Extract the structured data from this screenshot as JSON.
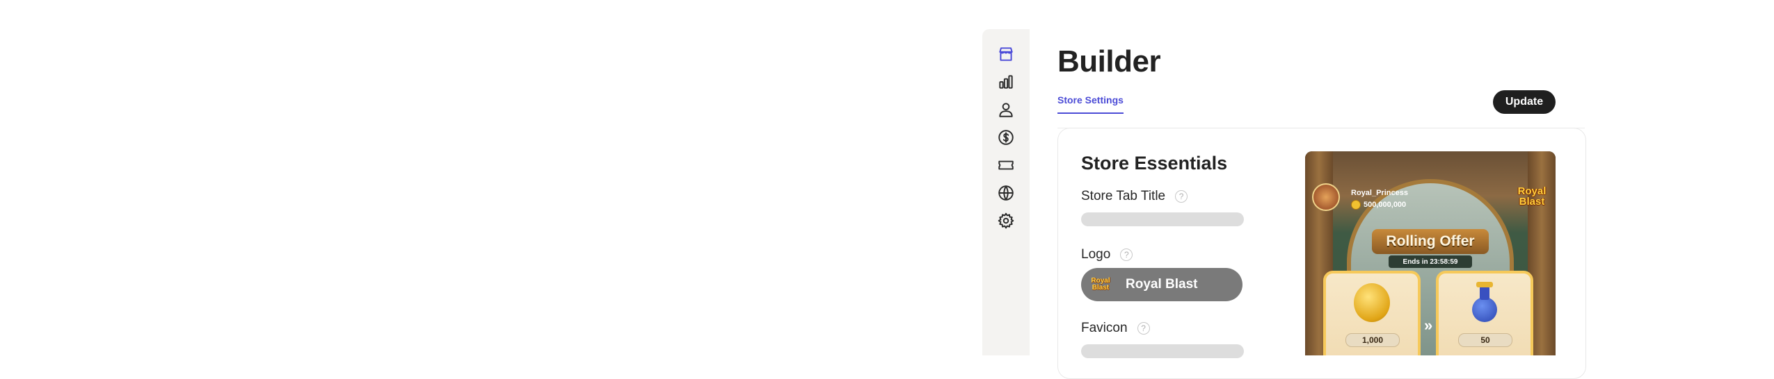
{
  "sidebar": {
    "items": [
      {
        "name": "store",
        "icon": "store-icon",
        "active": true
      },
      {
        "name": "analytics",
        "icon": "bar-chart-icon",
        "active": false
      },
      {
        "name": "users",
        "icon": "user-icon",
        "active": false
      },
      {
        "name": "pricing",
        "icon": "dollar-icon",
        "active": false
      },
      {
        "name": "offers",
        "icon": "ticket-icon",
        "active": false
      },
      {
        "name": "localization",
        "icon": "globe-icon",
        "active": false
      },
      {
        "name": "settings",
        "icon": "gear-icon",
        "active": false
      }
    ]
  },
  "header": {
    "title": "Builder",
    "tab_label": "Store Settings",
    "update_label": "Update"
  },
  "card": {
    "section_title": "Store Essentials",
    "store_tab_title_label": "Store Tab Title",
    "logo_label": "Logo",
    "logo_name": "Royal Blast",
    "favicon_label": "Favicon",
    "help_glyph": "?"
  },
  "preview": {
    "player_name": "Royal_Princess",
    "player_coins": "500,000,000",
    "game_logo_line1": "Royal",
    "game_logo_line2": "Blast",
    "offer_title": "Rolling Offer",
    "offer_ends": "Ends in 23:58:59",
    "items": [
      {
        "kind": "coin",
        "quantity": "1,000"
      },
      {
        "kind": "potion",
        "quantity": "50"
      }
    ]
  },
  "colors": {
    "accent": "#4b4bd6",
    "button_bg": "#1f1f1f",
    "sidebar_bg": "#f4f3f1",
    "logo_pill_bg": "#7a7a7a"
  }
}
